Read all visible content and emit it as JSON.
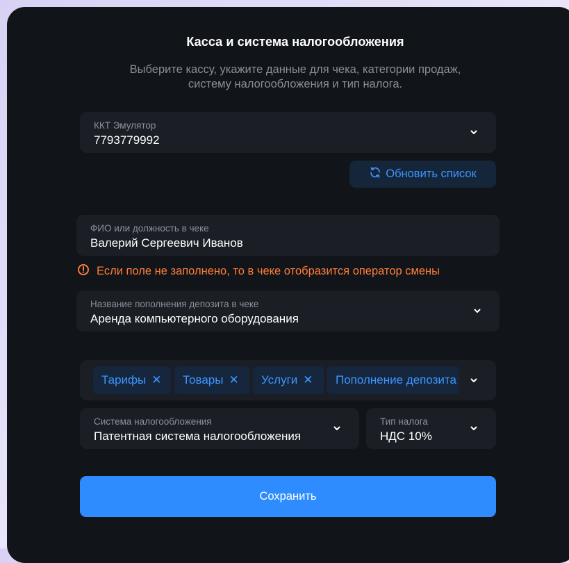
{
  "header": {
    "title": "Касса и система налогообложения",
    "subtitle_line1": "Выберите кассу, укажите данные для чека, категории продаж,",
    "subtitle_line2": "систему налогообложения и тип налога."
  },
  "kkt": {
    "label": "ККТ Эмулятор",
    "value": "7793779992"
  },
  "refresh_button": {
    "label": "Обновить список",
    "icon": "refresh-icon"
  },
  "fio": {
    "label": "ФИО или должность в чеке",
    "value": "Валерий Сергеевич Иванов"
  },
  "warning": {
    "text": "Если поле не заполнено, то в чеке отобразится оператор смены",
    "icon": "warning-icon"
  },
  "deposit": {
    "label": "Название пополнения депозита в чеке",
    "value": "Аренда компьютерного оборудования"
  },
  "categories": {
    "tags": [
      "Тарифы",
      "Товары",
      "Услуги",
      "Пополнение депозита"
    ]
  },
  "tax_system": {
    "label": "Система налогообложения",
    "value": "Патентная система налогообложения"
  },
  "tax_type": {
    "label": "Тип налога",
    "value": "НДС 10%"
  },
  "save_button": {
    "label": "Сохранить"
  },
  "colors": {
    "panel": "#111418",
    "field": "#1b1f25",
    "accent": "#2f8cff",
    "link": "#3d95ff",
    "warning": "#ff7d3b"
  }
}
